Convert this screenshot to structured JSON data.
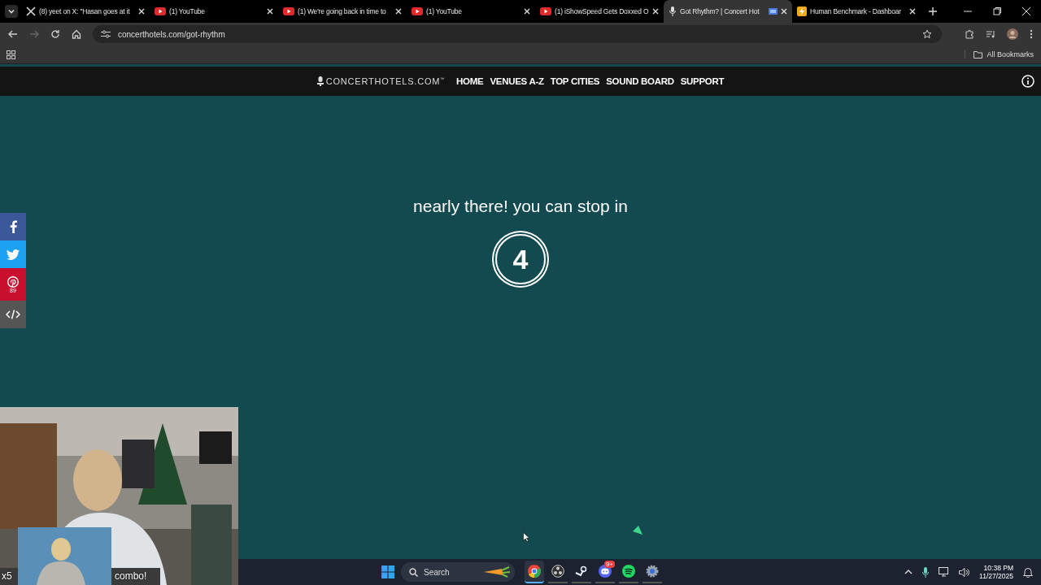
{
  "browser": {
    "tabs": [
      {
        "title": "(8) yeet on X: \"Hasan goes at it",
        "kind": "x",
        "selected": false,
        "media_indicator": false
      },
      {
        "title": "(1) YouTube",
        "kind": "youtube",
        "selected": false,
        "media_indicator": false
      },
      {
        "title": "(1) We're going back in time to",
        "kind": "youtube",
        "selected": false,
        "media_indicator": false
      },
      {
        "title": "(1) YouTube",
        "kind": "youtube",
        "selected": false,
        "media_indicator": false
      },
      {
        "title": "(1) iShowSpeed Gets Doxxed O",
        "kind": "youtube",
        "selected": false,
        "media_indicator": false
      },
      {
        "title": "Got Rhythm? | Concert Hot",
        "kind": "mic",
        "selected": true,
        "media_indicator": true
      },
      {
        "title": "Human Benchmark - Dashboar",
        "kind": "bolt",
        "selected": false,
        "media_indicator": false
      }
    ],
    "address": "concerthotels.com/got-rhythm",
    "bookmarks": "All Bookmarks"
  },
  "site": {
    "logo": "CONCERTHOTELS.COM$^{™}$",
    "nav": [
      "HOME",
      "VENUES A-Z",
      "TOP CITIES",
      "SOUND BOARD",
      "SUPPORT"
    ],
    "message": "nearly there! you can stop in",
    "countdown": "4",
    "social": [
      {
        "kind": "facebook"
      },
      {
        "kind": "twitter"
      },
      {
        "kind": "pinterest",
        "count": "89"
      },
      {
        "kind": "embed"
      }
    ]
  },
  "overlay": {
    "multiplier": "x5",
    "combo": "combo!"
  },
  "taskbar": {
    "search_placeholder": "Search",
    "apps": [
      {
        "kind": "chrome",
        "active": true
      },
      {
        "kind": "obs",
        "active": false
      },
      {
        "kind": "steam",
        "active": false
      },
      {
        "kind": "discord",
        "active": false,
        "badge": "9+"
      },
      {
        "kind": "spotify",
        "active": false
      },
      {
        "kind": "settings",
        "active": false
      }
    ],
    "time": "10:38 PM",
    "date": "11/27/2025"
  }
}
